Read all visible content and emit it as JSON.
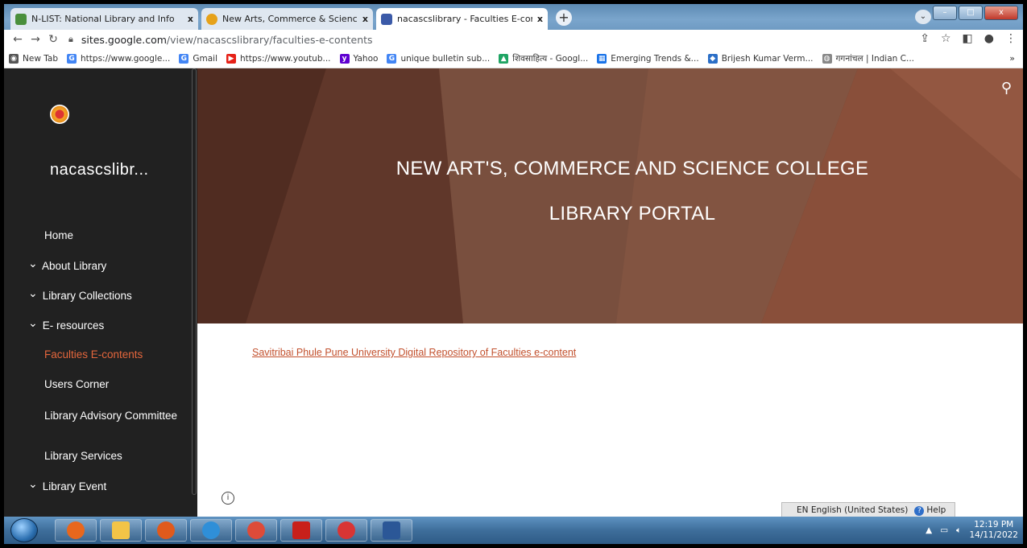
{
  "tabs": [
    {
      "title": "N-LIST: National Library and Info",
      "color": "#4a8f3c"
    },
    {
      "title": "New Arts, Commerce & Science",
      "color": "#e6a21a"
    },
    {
      "title": "nacascslibrary - Faculties E-conte",
      "color": "#3b5aa8"
    }
  ],
  "newtab_label": "+",
  "window_controls": {
    "minimize": "–",
    "maximize": "□",
    "close": "x"
  },
  "address": {
    "domain": "sites.google.com",
    "path": "/view/nacascslibrary/faculties-e-contents"
  },
  "bookmarks": [
    {
      "label": "New Tab",
      "icon": "globe-icon",
      "color": "#555555",
      "glyph": "◉"
    },
    {
      "label": "https://www.google...",
      "icon": "google-icon",
      "color": "#4285f4",
      "glyph": "G"
    },
    {
      "label": "Gmail",
      "icon": "google-icon",
      "color": "#4285f4",
      "glyph": "G"
    },
    {
      "label": "https://www.youtub...",
      "icon": "youtube-icon",
      "color": "#e62117",
      "glyph": "▶"
    },
    {
      "label": "Yahoo",
      "icon": "yahoo-icon",
      "color": "#5f01d1",
      "glyph": "y"
    },
    {
      "label": "unique bulletin sub...",
      "icon": "google-icon",
      "color": "#4285f4",
      "glyph": "G"
    },
    {
      "label": "शिवसाहित्य - Googl...",
      "icon": "drive-icon",
      "color": "#1fa463",
      "glyph": "▲"
    },
    {
      "label": "Emerging Trends &...",
      "icon": "sites-icon",
      "color": "#1a73e8",
      "glyph": "▦"
    },
    {
      "label": "Brijesh Kumar Verm...",
      "icon": "academic-icon",
      "color": "#2b6fc7",
      "glyph": "◆"
    },
    {
      "label": "गगनांचल | Indian C...",
      "icon": "globe-icon",
      "color": "#888888",
      "glyph": "◍"
    }
  ],
  "bookmarks_more": "»",
  "sidebar": {
    "site_name": "nacascslibr...",
    "items": [
      {
        "label": "Home",
        "chevron": false,
        "active": false
      },
      {
        "label": "About Library",
        "chevron": true,
        "active": false
      },
      {
        "label": "Library Collections",
        "chevron": true,
        "active": false
      },
      {
        "label": "E- resources",
        "chevron": true,
        "active": false
      },
      {
        "label": "Faculties E-contents",
        "chevron": false,
        "active": true
      },
      {
        "label": "Users Corner",
        "chevron": false,
        "active": false
      },
      {
        "label": "Library Advisory Committee",
        "chevron": false,
        "active": false
      },
      {
        "label": "Library Services",
        "chevron": false,
        "active": false
      },
      {
        "label": "Library Event",
        "chevron": true,
        "active": false
      }
    ]
  },
  "hero": {
    "line1": "NEW ART'S, COMMERCE AND SCIENCE COLLEGE",
    "line2": "LIBRARY PORTAL"
  },
  "content": {
    "link_text": "Savitribai Phule Pune University Digital Repository of Faculties e-content"
  },
  "langbar": {
    "language": "EN English (United States)",
    "help": "Help"
  },
  "taskbar": {
    "apps": [
      {
        "name": "firefox",
        "color": "#e8671d"
      },
      {
        "name": "file-explorer",
        "color": "#f2c447"
      },
      {
        "name": "media-player",
        "color": "#e05a1c"
      },
      {
        "name": "internet-explorer",
        "color": "#2f8fd8"
      },
      {
        "name": "chrome",
        "color": "#dd4b39"
      },
      {
        "name": "acrobat",
        "color": "#c8201b"
      },
      {
        "name": "pinwheel-app",
        "color": "#d83535"
      },
      {
        "name": "word",
        "color": "#2b5797"
      }
    ],
    "time": "12:19 PM",
    "date": "14/11/2022"
  },
  "colors": {
    "accent": "#e4663c",
    "sidebar_bg": "#212121",
    "link": "#c2502d"
  }
}
